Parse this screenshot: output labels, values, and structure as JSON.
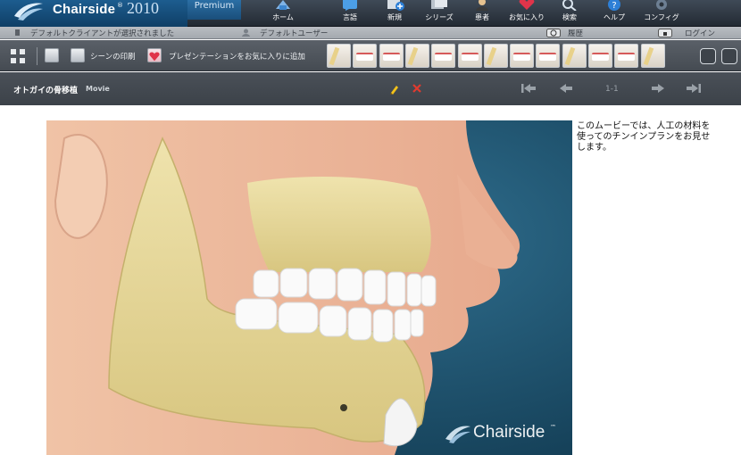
{
  "app": {
    "brand": "Chairside",
    "registered_mark": "®",
    "year": "2010",
    "edition": "Premium"
  },
  "nav": {
    "items": [
      {
        "label": "ホーム",
        "icon": "home-icon"
      },
      {
        "label": "言語",
        "icon": "language-icon"
      },
      {
        "label": "新規",
        "icon": "new-icon"
      },
      {
        "label": "シリーズ",
        "icon": "series-icon"
      },
      {
        "label": "患者",
        "icon": "patient-icon"
      },
      {
        "label": "お気に入り",
        "icon": "favorites-icon"
      },
      {
        "label": "検索",
        "icon": "search-icon"
      },
      {
        "label": "ヘルプ",
        "icon": "help-icon"
      },
      {
        "label": "コンフィグ",
        "icon": "config-icon"
      }
    ]
  },
  "status": {
    "client": "デフォルトクライアントが選択されました",
    "user": "デフォルトユーザー",
    "history": "履歴",
    "login": "ログイン"
  },
  "toolbar": {
    "print_scene": "シーンの印刷",
    "add_favorite": "プレゼンテーションをお気に入りに追加",
    "thumbnail_count": 13
  },
  "presentation": {
    "title": "オトガイの骨移植",
    "type": "Movie",
    "counter": "1-1"
  },
  "content": {
    "description": "このムービーでは、人工の材料を使ってのチンインプランをお見せします。",
    "watermark": "Chairside",
    "watermark_mark": "™"
  },
  "colors": {
    "header_bg": "#2a323b",
    "logo_bg": "#164b78",
    "toolbar_bg": "#50565d",
    "titlebar_bg": "#42484f",
    "movie_bg": "#1e5470",
    "edit_icon": "#f3c21a",
    "delete_icon": "#e03a2f"
  }
}
